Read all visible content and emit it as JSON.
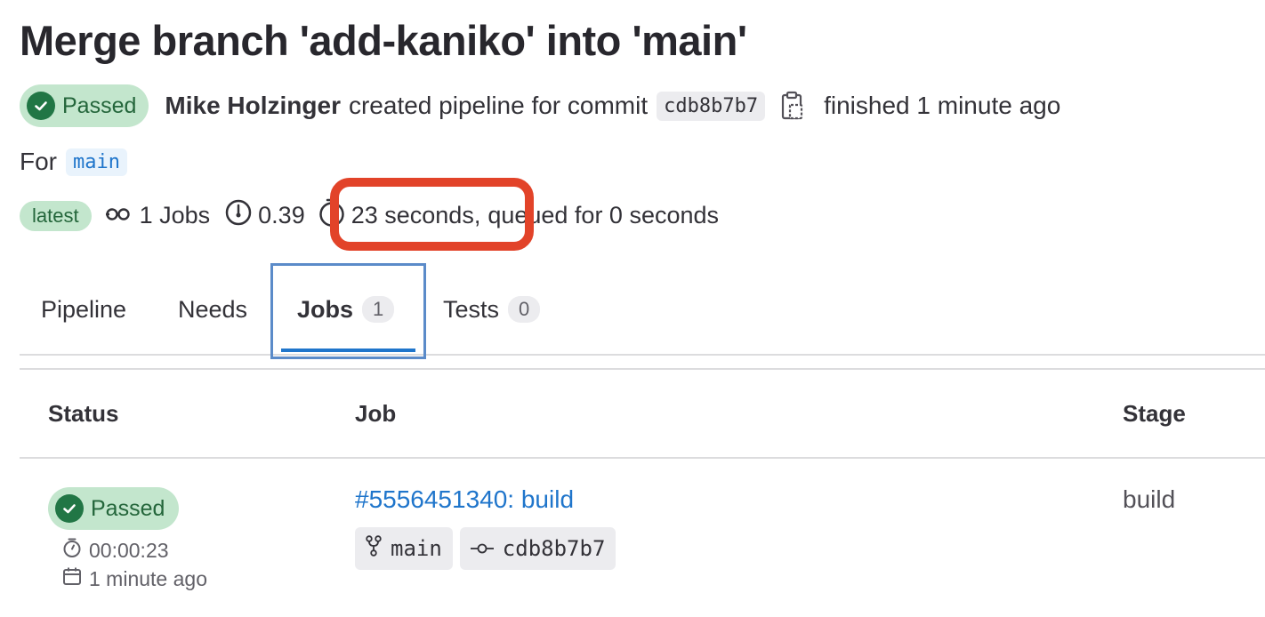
{
  "page": {
    "title": "Merge branch 'add-kaniko' into 'main'"
  },
  "pipeline": {
    "status_label": "Passed",
    "author": "Mike Holzinger",
    "created_text": "created pipeline for commit",
    "commit_sha": "cdb8b7b7",
    "finished_text": "finished 1 minute ago",
    "for_label": "For",
    "ref": "main",
    "badge": "latest",
    "jobs_count": "1 Jobs",
    "compute": "0.39",
    "duration": "23 seconds,",
    "queued": "queued for 0 seconds"
  },
  "tabs": [
    {
      "label": "Pipeline"
    },
    {
      "label": "Needs"
    },
    {
      "label": "Jobs",
      "count": "1",
      "active": true
    },
    {
      "label": "Tests",
      "count": "0"
    }
  ],
  "table": {
    "headers": {
      "status": "Status",
      "job": "Job",
      "stage": "Stage"
    },
    "rows": [
      {
        "status": "Passed",
        "duration": "00:00:23",
        "finished": "1 minute ago",
        "job": "#5556451340: build",
        "ref": "main",
        "sha": "cdb8b7b7",
        "stage": "build"
      }
    ]
  },
  "colors": {
    "success": "#217645",
    "link": "#1f75cb",
    "highlight": "#e24329"
  },
  "icons": [
    "check-circle-icon",
    "copy-icon",
    "pipeline-icon",
    "gauge-icon",
    "timer-icon",
    "calendar-icon",
    "branch-icon",
    "commit-icon"
  ]
}
